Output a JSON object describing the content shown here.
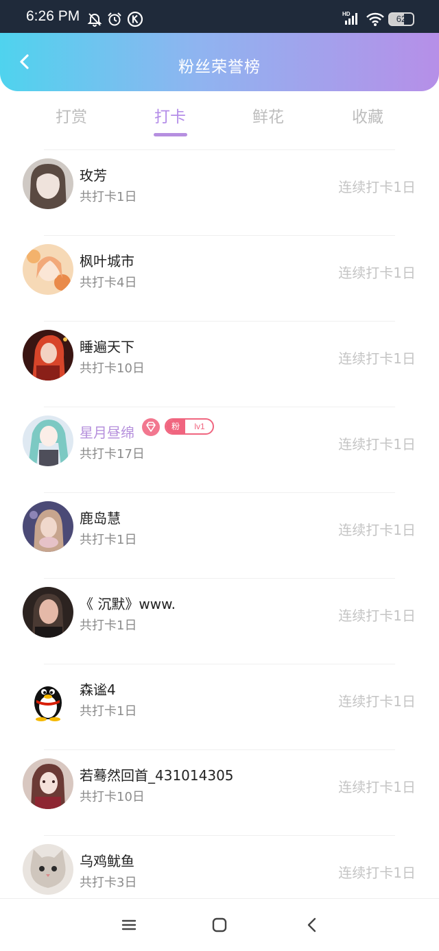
{
  "status_bar": {
    "time": "6:26 PM",
    "battery": "62",
    "icons": [
      "bell-off-icon",
      "alarm-icon",
      "k-app-icon",
      "hd-signal-icon",
      "wifi-icon",
      "battery-icon"
    ]
  },
  "header": {
    "title": "粉丝荣誉榜",
    "back_icon": "chevron-left-icon",
    "gradient": [
      "#4fd3ee",
      "#8fb4f0",
      "#b68fe8"
    ]
  },
  "tabs": [
    {
      "label": "打赏",
      "active": false
    },
    {
      "label": "打卡",
      "active": true
    },
    {
      "label": "鲜花",
      "active": false
    },
    {
      "label": "收藏",
      "active": false
    }
  ],
  "accent_color": "#b48de8",
  "fans": [
    {
      "name": "玫芳",
      "total": "共打卡1日",
      "streak": "连续打卡1日"
    },
    {
      "name": "枫叶城市",
      "total": "共打卡4日",
      "streak": "连续打卡1日"
    },
    {
      "name": "睡遍天下",
      "total": "共打卡10日",
      "streak": "连续打卡1日"
    },
    {
      "name": "星月昼绵",
      "total": "共打卡17日",
      "streak": "连续打卡1日",
      "vip": true,
      "fan_badge": "粉",
      "fan_level": "lv1"
    },
    {
      "name": "鹿岛慧",
      "total": "共打卡1日",
      "streak": "连续打卡1日"
    },
    {
      "name": "《 沉默》www.",
      "total": "共打卡1日",
      "streak": "连续打卡1日"
    },
    {
      "name": "森谧4",
      "total": "共打卡1日",
      "streak": "连续打卡1日"
    },
    {
      "name": "若蓦然回首_431014305",
      "total": "共打卡10日",
      "streak": "连续打卡1日"
    },
    {
      "name": "乌鸡鱿鱼",
      "total": "共打卡3日",
      "streak": "连续打卡1日"
    }
  ],
  "nav_bar": {
    "icons": [
      "menu-icon",
      "home-square-icon",
      "back-arrow-icon"
    ]
  }
}
